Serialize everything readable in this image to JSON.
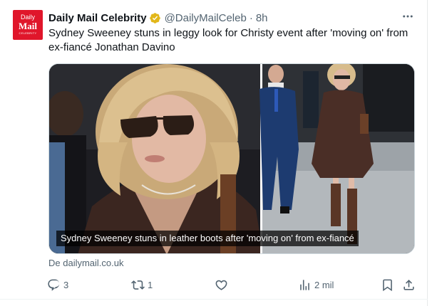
{
  "tweet": {
    "avatar": {
      "line1": "Daily",
      "line2": "Mail",
      "line3": "CELEBRITY"
    },
    "display_name": "Daily Mail Celebrity",
    "handle": "@DailyMailCeleb",
    "separator": "·",
    "time": "8h",
    "text": "Sydney Sweeney stuns in leggy look for Christy event after 'moving on' from ex-fiancé Jonathan Davino",
    "media": {
      "caption": "Sydney Sweeney stuns in leather boots after 'moving on' from ex-fiancé"
    },
    "source": "De dailymail.co.uk",
    "actions": {
      "replies": "3",
      "reposts": "1",
      "likes": "",
      "views": "2 mil"
    }
  },
  "colors": {
    "brand_red": "#e0162b",
    "verified_gold": "#e2b719",
    "secondary_text": "#536471"
  },
  "icons": [
    "verified-badge-icon",
    "more-icon",
    "reply-icon",
    "repost-icon",
    "like-icon",
    "views-icon",
    "bookmark-icon",
    "share-icon"
  ]
}
